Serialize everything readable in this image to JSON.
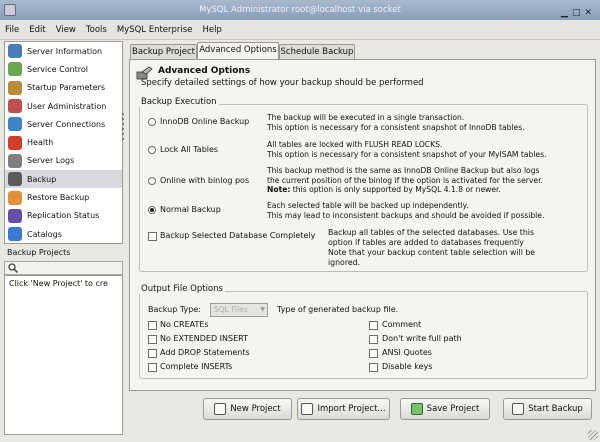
{
  "window": {
    "title": "MySQL Administrator root@localhost via socket"
  },
  "menu": [
    "File",
    "Edit",
    "View",
    "Tools",
    "MySQL Enterprise",
    "Help"
  ],
  "sidebar": {
    "items": [
      {
        "label": "Server Information",
        "icon": "server-info-icon",
        "color": "#4a7bbd"
      },
      {
        "label": "Service Control",
        "icon": "service-control-icon",
        "color": "#6aa84f"
      },
      {
        "label": "Startup Parameters",
        "icon": "startup-parameters-icon",
        "color": "#b88a3a"
      },
      {
        "label": "User Administration",
        "icon": "user-admin-icon",
        "color": "#c0504d"
      },
      {
        "label": "Server Connections",
        "icon": "connections-icon",
        "color": "#3d85c6"
      },
      {
        "label": "Health",
        "icon": "health-icon",
        "color": "#cc4125"
      },
      {
        "label": "Server Logs",
        "icon": "server-logs-icon",
        "color": "#7f7f7f"
      },
      {
        "label": "Backup",
        "icon": "backup-icon",
        "color": "#5b5b5b",
        "selected": true
      },
      {
        "label": "Restore Backup",
        "icon": "restore-backup-icon",
        "color": "#e69138"
      },
      {
        "label": "Replication Status",
        "icon": "replication-icon",
        "color": "#674ea7"
      },
      {
        "label": "Catalogs",
        "icon": "catalogs-icon",
        "color": "#3c78d8"
      }
    ]
  },
  "backup_projects": {
    "header": "Backup Projects",
    "hint": "Click 'New Project' to cre"
  },
  "tabs": [
    {
      "label": "Backup Project",
      "active": false
    },
    {
      "label": "Advanced Options",
      "active": true
    },
    {
      "label": "Schedule Backup",
      "active": false
    }
  ],
  "advanced": {
    "title": "Advanced Options",
    "subtitle": "Specify detailed settings of how your backup should be performed"
  },
  "execution": {
    "title": "Backup Execution",
    "options": [
      {
        "label": "InnoDB Online Backup",
        "checked": false,
        "desc": [
          "The backup will be executed in a single transaction.",
          "This option is necessary for a consistent snapshot of InnoDB tables."
        ]
      },
      {
        "label": "Lock All Tables",
        "checked": false,
        "desc": [
          "All tables are locked with FLUSH READ LOCKS.",
          "This option is necessary for a consistent snapshot of your MyISAM tables."
        ]
      },
      {
        "label": "Online with binlog pos",
        "checked": false,
        "desc": [
          "This backup method is the same as InnoDB Online Backup but also logs",
          "the current position of the binlog if the option is activated for the server."
        ],
        "note_bold": "Note:",
        "note_rest": " this option is only supported by MySQL 4.1.8 or newer."
      },
      {
        "label": "Normal Backup",
        "checked": true,
        "desc": [
          "Each selected table will be backed up independently.",
          "This may lead to inconsistent backups and should be avoided if possible."
        ]
      }
    ],
    "complete": {
      "label": "Backup Selected Database Completely",
      "checked": false,
      "desc": [
        "Backup all tables of the selected databases. Use this",
        "option if tables are added to databases frequently",
        "Note that your backup content table selection will be",
        "ignored."
      ]
    }
  },
  "output": {
    "title": "Output File Options",
    "backup_type_label": "Backup Type:",
    "backup_type_value": "SQL Files",
    "backup_type_desc": "Type of generated backup file.",
    "left_options": [
      {
        "label": "No CREATEs",
        "checked": false
      },
      {
        "label": "No EXTENDED INSERT",
        "checked": false
      },
      {
        "label": "Add DROP Statements",
        "checked": false
      },
      {
        "label": "Complete INSERTs",
        "checked": false
      }
    ],
    "right_options": [
      {
        "label": "Comment",
        "checked": false
      },
      {
        "label": "Don't write full path",
        "checked": false
      },
      {
        "label": "ANSI Quotes",
        "checked": false
      },
      {
        "label": "Disable keys",
        "checked": false
      }
    ]
  },
  "buttons": {
    "new_project": "New Project",
    "import_project": "Import Project...",
    "save_project": "Save Project",
    "start_backup": "Start Backup"
  }
}
